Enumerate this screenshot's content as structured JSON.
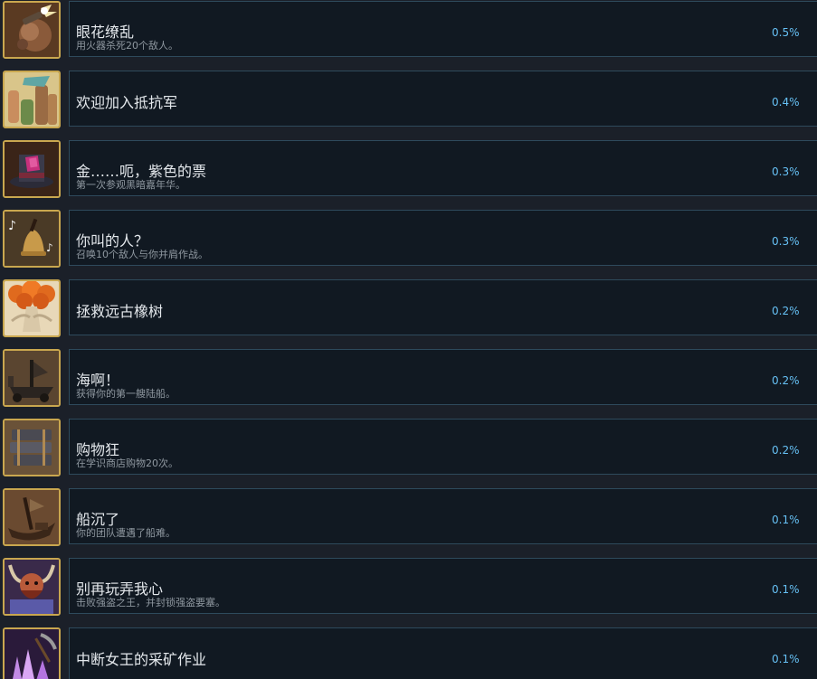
{
  "achievements": [
    {
      "title": "眼花缭乱",
      "desc": "用火器杀死20个敌人。",
      "pct": "0.5%",
      "icon": "gun-fire-icon"
    },
    {
      "title": "欢迎加入抵抗军",
      "desc": "",
      "pct": "0.4%",
      "icon": "raised-fists-icon"
    },
    {
      "title": "金……呃，紫色的票",
      "desc": "第一次参观黑暗嘉年华。",
      "pct": "0.3%",
      "icon": "top-hat-icon"
    },
    {
      "title": "你叫的人？",
      "desc": "召唤10个敌人与你并肩作战。",
      "pct": "0.3%",
      "icon": "bell-music-icon"
    },
    {
      "title": "拯救远古橡树",
      "desc": "",
      "pct": "0.2%",
      "icon": "ancient-oak-icon"
    },
    {
      "title": "海啊！",
      "desc": "获得你的第一艘陆船。",
      "pct": "0.2%",
      "icon": "land-ship-icon"
    },
    {
      "title": "购物狂",
      "desc": "在学识商店购物20次。",
      "pct": "0.2%",
      "icon": "books-stack-icon"
    },
    {
      "title": "船沉了",
      "desc": "你的团队遭遇了船难。",
      "pct": "0.1%",
      "icon": "sunken-ship-icon"
    },
    {
      "title": "别再玩弄我心",
      "desc": "击败强盗之王，并封锁强盗要塞。",
      "pct": "0.1%",
      "icon": "bandit-king-icon"
    },
    {
      "title": "中断女王的采矿作业",
      "desc": "",
      "pct": "0.1%",
      "icon": "crystal-pickaxe-icon"
    }
  ],
  "colors": {
    "background": "#1b2029",
    "panel": "#111922",
    "panel_border": "#2e4a5c",
    "title": "#e4e8ec",
    "desc": "#8f98a0",
    "percent": "#66c0f4",
    "icon_frame": "#c9a74f"
  }
}
